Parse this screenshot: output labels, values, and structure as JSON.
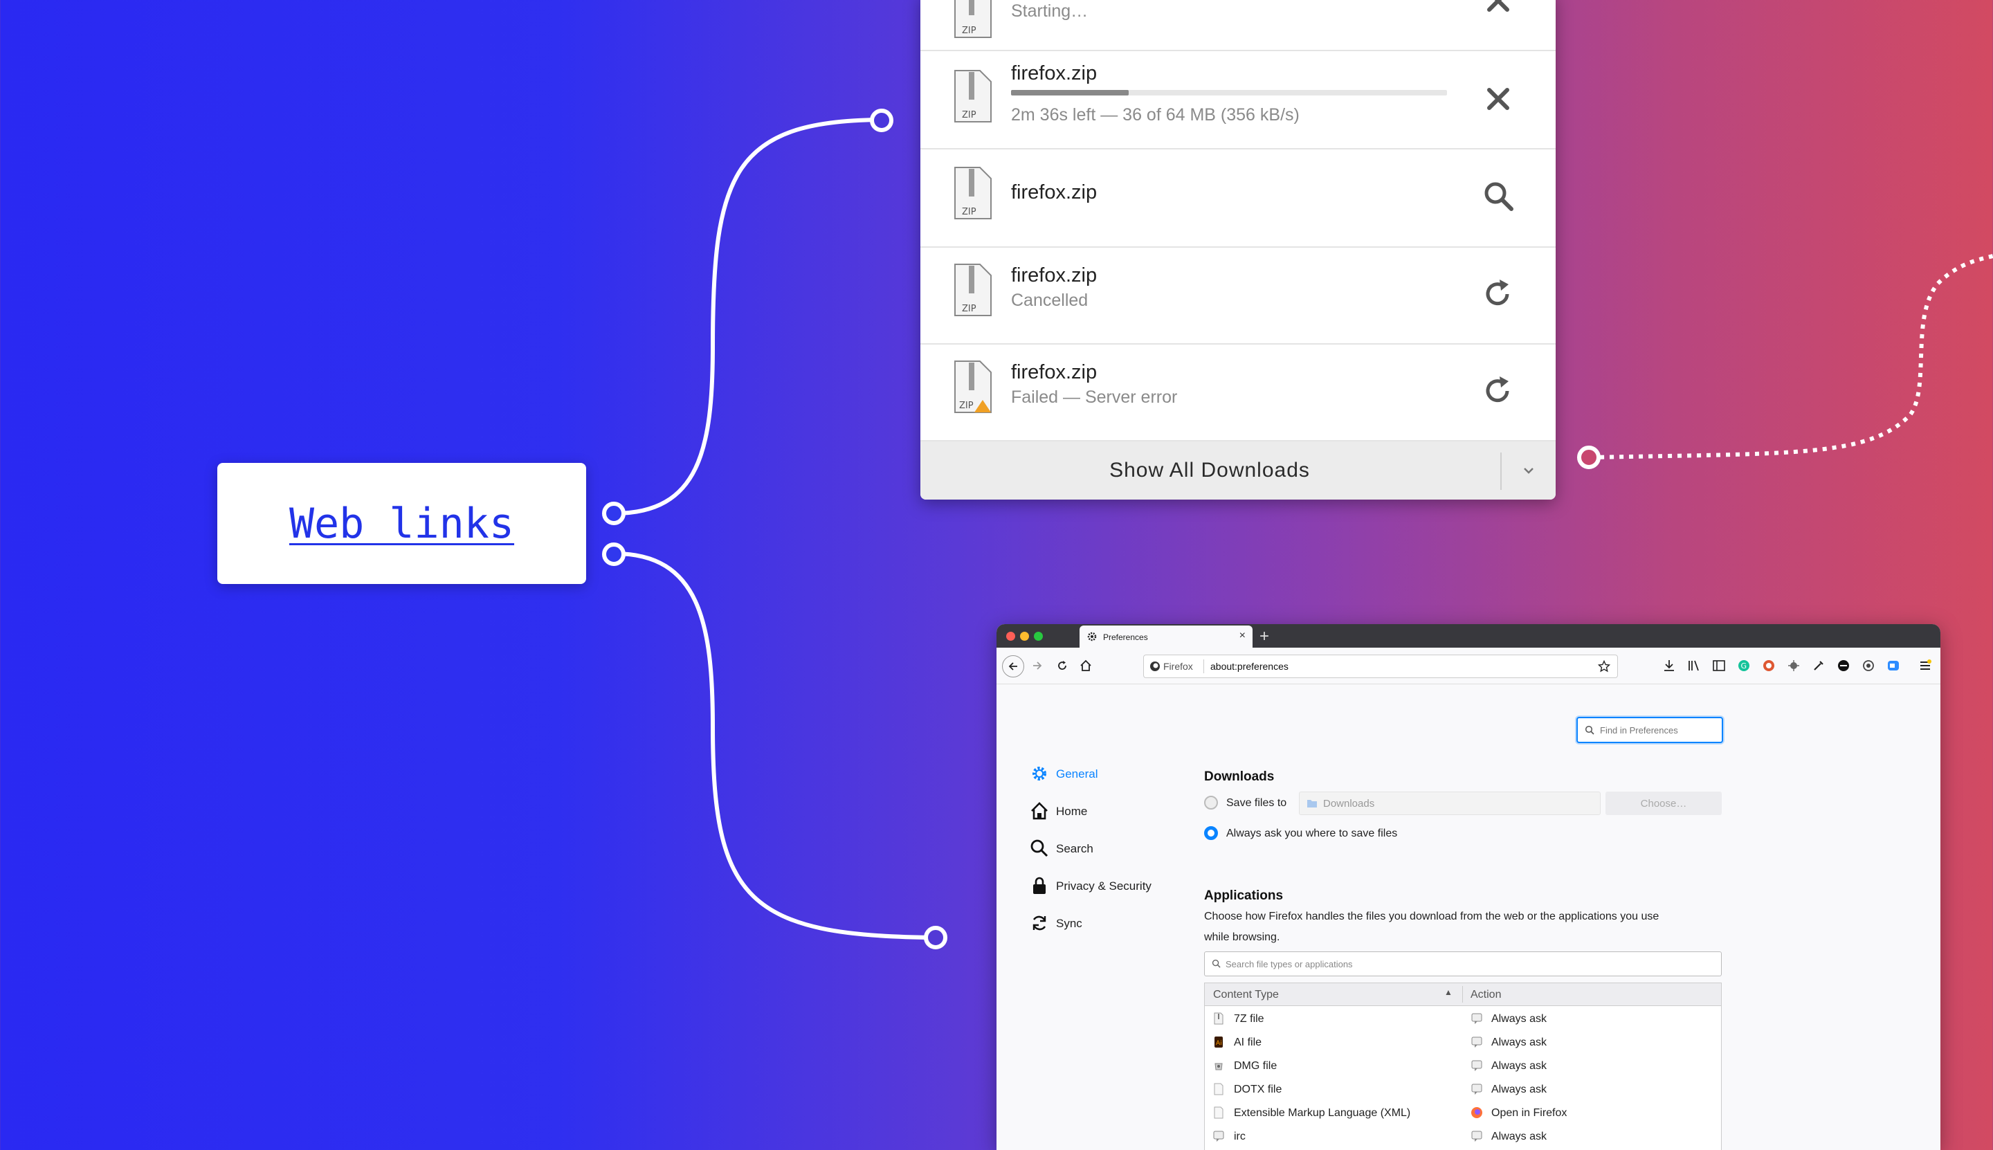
{
  "weblinks": {
    "label": "Web links"
  },
  "downloads": {
    "items": [
      {
        "file_icon_label": "ZIP",
        "name": "",
        "status": "Starting…",
        "action": "cancel"
      },
      {
        "file_icon_label": "ZIP",
        "name": "firefox.zip",
        "status": "2m 36s left — 36 of 64 MB (356 kB/s)",
        "progress": 0.27,
        "action": "cancel"
      },
      {
        "file_icon_label": "ZIP",
        "name": "firefox.zip",
        "status": "",
        "action": "show-in-folder"
      },
      {
        "file_icon_label": "ZIP",
        "name": "firefox.zip",
        "status": "Cancelled",
        "action": "retry"
      },
      {
        "file_icon_label": "ZIP",
        "name": "firefox.zip",
        "status": "Failed — Server error",
        "action": "retry"
      }
    ],
    "show_all": "Show All Downloads"
  },
  "firefox": {
    "tab_title": "Preferences",
    "identity": "Firefox",
    "url": "about:preferences",
    "find_placeholder": "Find in Preferences",
    "sidebar": [
      {
        "label": "General",
        "icon": "gear-icon",
        "active": true
      },
      {
        "label": "Home",
        "icon": "home-icon"
      },
      {
        "label": "Search",
        "icon": "search-icon"
      },
      {
        "label": "Privacy & Security",
        "icon": "lock-icon"
      },
      {
        "label": "Sync",
        "icon": "sync-icon"
      }
    ],
    "downloads_section": {
      "title": "Downloads",
      "save_files_label": "Save files to",
      "folder": "Downloads",
      "choose_button": "Choose…",
      "always_ask_label": "Always ask you where to save files",
      "selected": "always-ask"
    },
    "applications_section": {
      "title": "Applications",
      "description_line1": "Choose how Firefox handles the files you download from the web or the applications you use",
      "description_line2": "while browsing.",
      "search_placeholder": "Search file types or applications",
      "columns": [
        "Content Type",
        "Action"
      ],
      "rows": [
        {
          "type": "7Z file",
          "action": "Always ask"
        },
        {
          "type": "AI file",
          "action": "Always ask"
        },
        {
          "type": "DMG file",
          "action": "Always ask"
        },
        {
          "type": "DOTX file",
          "action": "Always ask"
        },
        {
          "type": "Extensible Markup Language (XML)",
          "action": "Open in Firefox"
        },
        {
          "type": "irc",
          "action": "Always ask"
        }
      ]
    }
  },
  "colors": {
    "accent": "#0a84ff",
    "link": "#2233e8"
  }
}
